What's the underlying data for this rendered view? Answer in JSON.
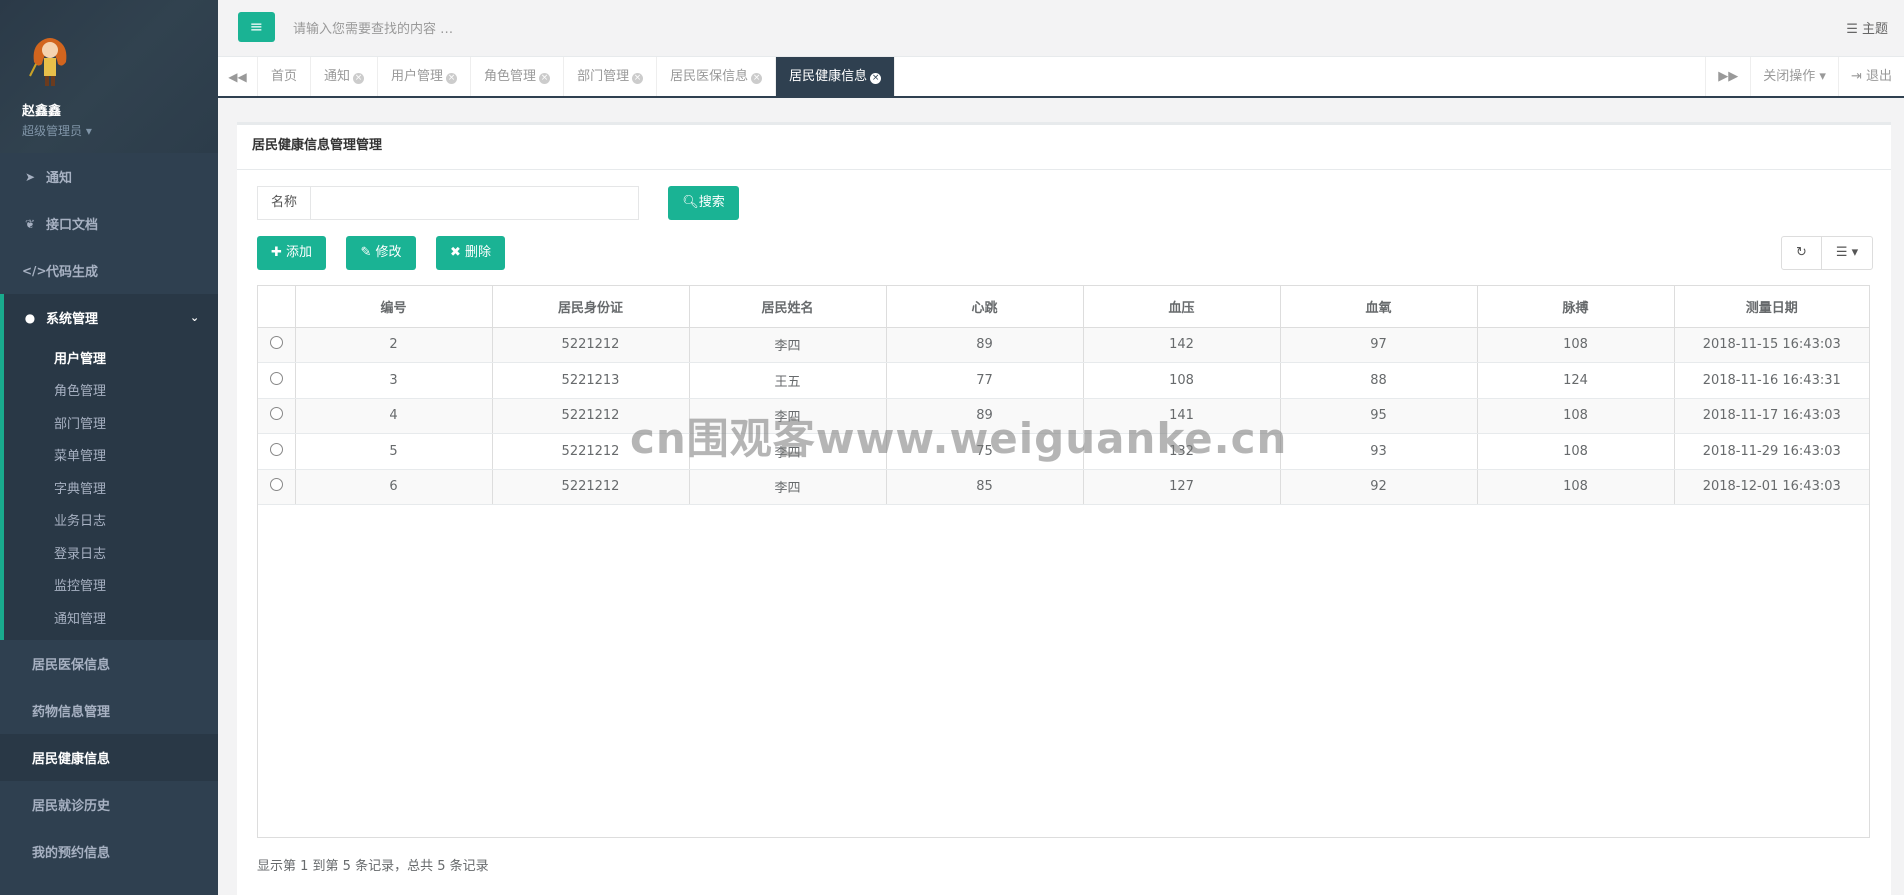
{
  "user": {
    "name": "赵鑫鑫",
    "role": "超级管理员"
  },
  "nav": {
    "top_items": [
      {
        "label": "通知",
        "icon": "paper-plane-icon"
      },
      {
        "label": "接口文档",
        "icon": "leaf-icon"
      },
      {
        "label": "代码生成",
        "icon": "code-icon"
      }
    ],
    "group": {
      "label": "系统管理",
      "icon": "user-icon"
    },
    "sub_items": [
      "用户管理",
      "角色管理",
      "部门管理",
      "菜单管理",
      "字典管理",
      "业务日志",
      "登录日志",
      "监控管理",
      "通知管理"
    ],
    "bottom_items": [
      "居民医保信息",
      "药物信息管理",
      "居民健康信息",
      "居民就诊历史",
      "我的预约信息"
    ]
  },
  "topbar": {
    "search_placeholder": "请输入您需要查找的内容 …",
    "theme": "主题"
  },
  "tabs": [
    "首页",
    "通知",
    "用户管理",
    "角色管理",
    "部门管理",
    "居民医保信息",
    "居民健康信息"
  ],
  "tabs_right": {
    "close_ops": "关闭操作",
    "logout": "退出"
  },
  "panel": {
    "title": "居民健康信息管理管理",
    "search_label": "名称",
    "search_btn": "搜索",
    "add_btn": "添加",
    "edit_btn": "修改",
    "delete_btn": "删除"
  },
  "table": {
    "headers": [
      "编号",
      "居民身份证",
      "居民姓名",
      "心跳",
      "血压",
      "血氧",
      "脉搏",
      "测量日期"
    ],
    "rows": [
      [
        "2",
        "5221212",
        "李四",
        "89",
        "142",
        "97",
        "108",
        "2018-11-15 16:43:03"
      ],
      [
        "3",
        "5221213",
        "王五",
        "77",
        "108",
        "88",
        "124",
        "2018-11-16 16:43:31"
      ],
      [
        "4",
        "5221212",
        "李四",
        "89",
        "141",
        "95",
        "108",
        "2018-11-17 16:43:03"
      ],
      [
        "5",
        "5221212",
        "李四",
        "75",
        "132",
        "93",
        "108",
        "2018-11-29 16:43:03"
      ],
      [
        "6",
        "5221212",
        "李四",
        "85",
        "127",
        "92",
        "108",
        "2018-12-01 16:43:03"
      ]
    ]
  },
  "footer": "显示第 1 到第 5 条记录，总共 5 条记录",
  "watermark": "cn围观客www.weiguanke.cn"
}
